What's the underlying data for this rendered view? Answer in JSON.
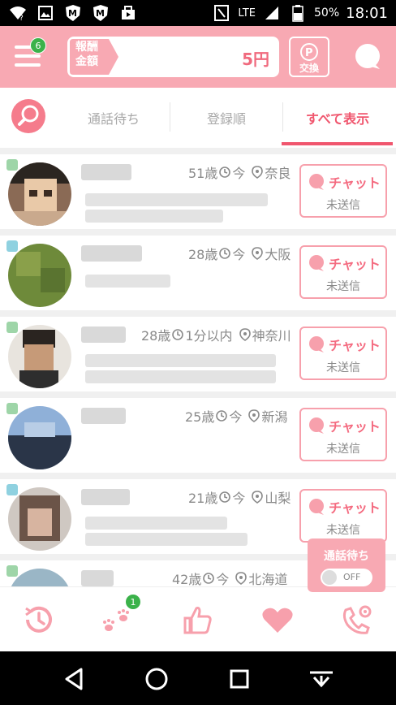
{
  "status_bar": {
    "network": "LTE",
    "battery": "50%",
    "time": "18:01",
    "icons": [
      "wifi-question-icon",
      "image-icon",
      "m-shield-icon",
      "m-shield-icon",
      "shopping-bag-icon",
      "nfc-icon",
      "signal-icon",
      "battery-icon"
    ]
  },
  "header": {
    "menu_badge": "6",
    "reward_label": "報酬\n金額",
    "reward_value": "5円",
    "exchange_label": "交換",
    "colors": {
      "header_bg": "#f8a9b3",
      "accent": "#f0566e"
    }
  },
  "tabs": {
    "items": [
      {
        "label": "通話待ち",
        "active": false
      },
      {
        "label": "登録順",
        "active": false
      },
      {
        "label": "すべて表示",
        "active": true
      }
    ]
  },
  "list": {
    "chat_label": "チャット",
    "unsent_label": "未送信",
    "rows": [
      {
        "age": "51歳",
        "login": "今",
        "location": "奈良"
      },
      {
        "age": "28歳",
        "login": "今",
        "location": "大阪"
      },
      {
        "age": "28歳",
        "login": "1分以内",
        "location": "神奈川"
      },
      {
        "age": "25歳",
        "login": "今",
        "location": "新潟"
      },
      {
        "age": "21歳",
        "login": "今",
        "location": "山梨"
      },
      {
        "age": "42歳",
        "login": "今",
        "location": "北海道"
      }
    ]
  },
  "waiting_popup": {
    "title": "通話待ち",
    "toggle": "OFF"
  },
  "bottom_nav": {
    "items": [
      "history-icon",
      "footprints-icon",
      "like-icon",
      "heart-icon",
      "phone-settings-icon"
    ],
    "footprints_badge": "1"
  },
  "android_nav": [
    "back-icon",
    "home-icon",
    "recents-icon",
    "notification-pull-icon"
  ]
}
